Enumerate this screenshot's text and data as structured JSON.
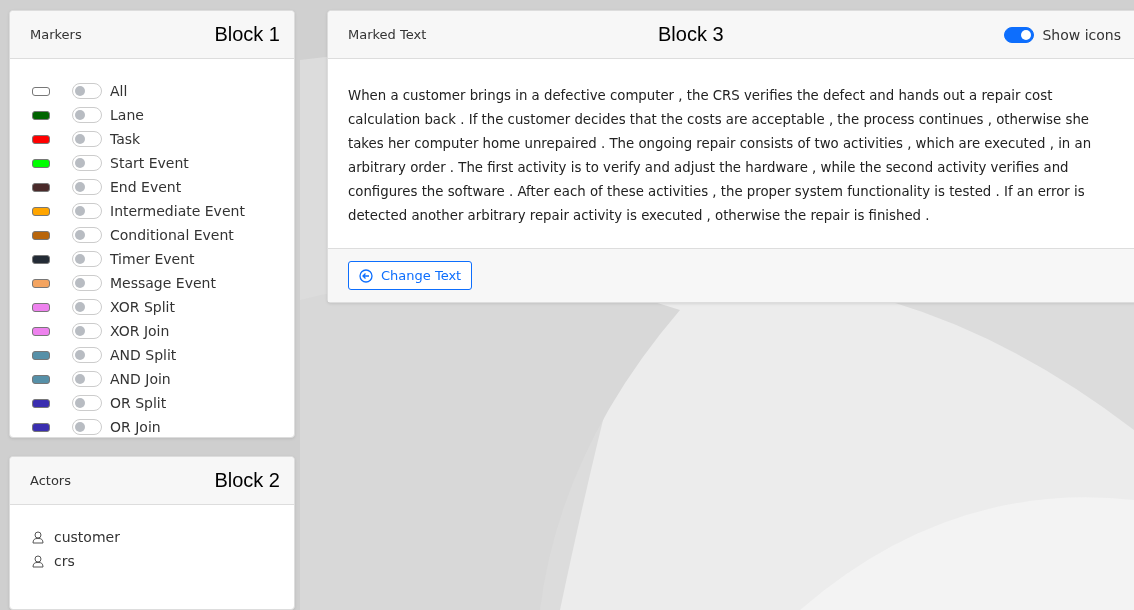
{
  "markers_panel": {
    "title": "Markers",
    "block_label": "Block 1",
    "items": [
      {
        "label": "All",
        "color": "#ffffff",
        "on": false
      },
      {
        "label": "Lane",
        "color": "#006400",
        "on": false
      },
      {
        "label": "Task",
        "color": "#ff0000",
        "on": false
      },
      {
        "label": "Start Event",
        "color": "#00ff00",
        "on": false
      },
      {
        "label": "End Event",
        "color": "#4a2a2a",
        "on": false
      },
      {
        "label": "Intermediate Event",
        "color": "#ffa500",
        "on": false
      },
      {
        "label": "Conditional Event",
        "color": "#b8650b",
        "on": false
      },
      {
        "label": "Timer Event",
        "color": "#232b35",
        "on": false
      },
      {
        "label": "Message Event",
        "color": "#f4a460",
        "on": false
      },
      {
        "label": "XOR Split",
        "color": "#ee82ee",
        "on": false
      },
      {
        "label": "XOR Join",
        "color": "#ee82ee",
        "on": false
      },
      {
        "label": "AND Split",
        "color": "#5690a8",
        "on": false
      },
      {
        "label": "AND Join",
        "color": "#5690a8",
        "on": false
      },
      {
        "label": "OR Split",
        "color": "#3a2eb0",
        "on": false
      },
      {
        "label": "OR Join",
        "color": "#3a2eb0",
        "on": false
      }
    ]
  },
  "actors_panel": {
    "title": "Actors",
    "block_label": "Block 2",
    "actors": [
      "customer",
      "crs"
    ]
  },
  "marked_text_panel": {
    "title": "Marked Text",
    "block_label": "Block 3",
    "show_icons": {
      "label": "Show icons",
      "on": true
    },
    "text": "When a customer brings in a defective computer , the CRS verifies the defect and hands out a repair cost calculation back . If the customer decides that the costs are acceptable , the process continues , otherwise she takes her computer home unrepaired . The ongoing repair consists of two activities , which are executed , in an arbitrary order . The first activity is to verify and adjust the hardware , while the second activity verifies and configures the software . After each of these activities , the proper system functionality is tested . If an error is detected another arbitrary repair activity is executed , otherwise the repair is finished .",
    "button": "Change Text"
  }
}
